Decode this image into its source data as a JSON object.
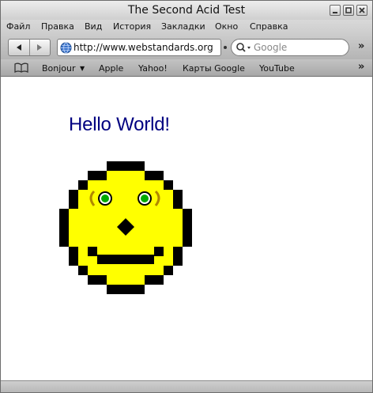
{
  "window": {
    "title": "The Second Acid Test"
  },
  "menu": [
    "Файл",
    "Правка",
    "Вид",
    "История",
    "Закладки",
    "Окно",
    "Справка"
  ],
  "toolbar": {
    "address": "http://www.webstandards.org",
    "search_placeholder": "Google",
    "more": "»"
  },
  "bookmarks": {
    "items": [
      "Bonjour",
      "Apple",
      "Yahoo!",
      "Карты Google",
      "YouTube"
    ],
    "bonjour_arrow": "▼",
    "more": "»"
  },
  "page": {
    "heading": "Hello World!",
    "face": {
      "skin_color": "#ffff00",
      "outline_color": "#000000",
      "iris_color": "#00aa00",
      "brow_color": "#b08800"
    }
  },
  "colors": {
    "heading": "#000080"
  }
}
